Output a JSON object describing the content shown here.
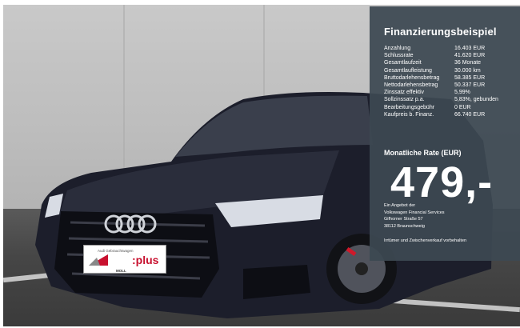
{
  "financing": {
    "title": "Finanzierungsbeispiel",
    "rows": [
      {
        "label": "Anzahlung",
        "value": "16.403 EUR"
      },
      {
        "label": "Schlussrate",
        "value": "41.620 EUR"
      },
      {
        "label": "Gesamtlaufzeit",
        "value": "36 Monate"
      },
      {
        "label": "Gesamtlaufleistung",
        "value": "30.000 km"
      },
      {
        "label": "Bruttodarlehensbetrag",
        "value": "58.385 EUR"
      },
      {
        "label": "Nettodarlehensbetrag",
        "value": "50.337 EUR"
      },
      {
        "label": "Zinssatz effektiv",
        "value": "5,99%"
      },
      {
        "label": "Sollzinssatz p.a.",
        "value": "5,83%, gebunden"
      },
      {
        "label": "Bearbeitungsgebühr",
        "value": "0 EUR"
      },
      {
        "label": "Kaufpreis b. Finanz.",
        "value": "66.740 EUR"
      }
    ],
    "rate_label": "Monatliche Rate (EUR)",
    "rate_value": "479,-",
    "provider": [
      "Ein Angebot der",
      "Volkswagen Financial Services",
      "Gifhorner Straße 57",
      "38112 Braunschweig"
    ],
    "disclaimer": "Irrtümer und Zwischenverkauf vorbehalten"
  },
  "plate": {
    "small_text": "Audi Gebrauchtwagen",
    "brand": ":plus",
    "dealer": "MOLL"
  },
  "colors": {
    "panel": "#3c4852",
    "brand_red": "#c8102e",
    "car_body": "#1c1e2b"
  },
  "icons": {
    "logo": "audi-rings-logo"
  }
}
